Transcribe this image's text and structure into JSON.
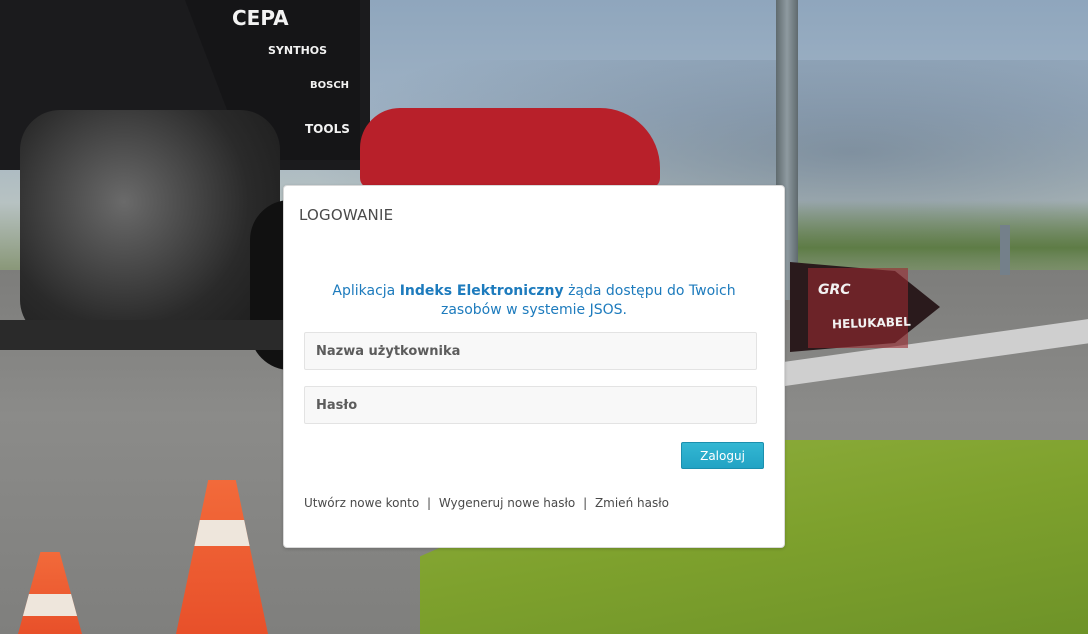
{
  "background": {
    "sponsors": [
      "CEPA",
      "SYNTHOS",
      "BOSCH",
      "TOOLS",
      "HELUKABEL",
      "GRC"
    ]
  },
  "login": {
    "title": "LOGOWANIE",
    "info_prefix": "Aplikacja",
    "app_name": "Indeks Elektroniczny",
    "info_suffix": "żąda dostępu do Twoich zasobów w systemie JSOS.",
    "username_placeholder": "Nazwa użytkownika",
    "password_placeholder": "Hasło",
    "submit_label": "Zaloguj",
    "links": {
      "create_account": "Utwórz nowe konto",
      "generate_password": "Wygeneruj nowe hasło",
      "change_password": "Zmień hasło",
      "separator": "|"
    }
  },
  "colors": {
    "accent": "#1d7bbd",
    "button": "#2bafcf"
  }
}
